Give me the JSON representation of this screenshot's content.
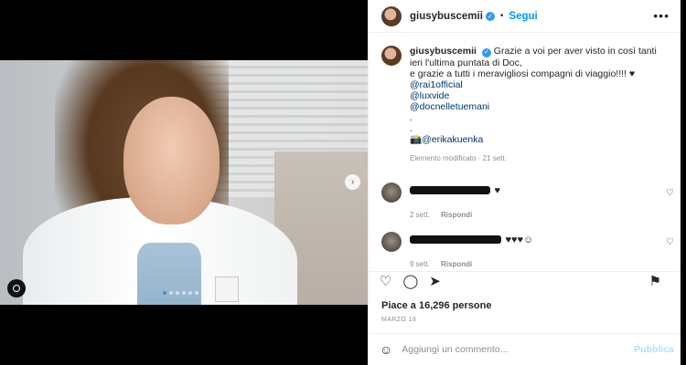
{
  "post": {
    "username": "giusybuscemii",
    "separator": "•",
    "follow_label": "Segui",
    "more_icon": "more-icon",
    "caption": {
      "username": "giusybuscemii",
      "line1": "Grazie a voi per aver visto in così tanti ieri l'ultima puntata di Doc,",
      "line2": "e grazie a tutti i meravigliosi compagni di viaggio!!!! ♥",
      "mentions": [
        "@rai1official",
        "@luxvide",
        "@docnelletuemani"
      ],
      "dots": [
        ".",
        "."
      ],
      "photo_credit": "📸@erikakuenka",
      "meta": "Elemento modificato · 21 sett."
    },
    "comments": [
      {
        "suffix": "♥",
        "time": "2 sett.",
        "reply_label": "Rispondi"
      },
      {
        "suffix": "♥♥♥☺",
        "time": "9 sett.",
        "reply_label": "Rispondi"
      }
    ],
    "likes": "Piace a 16,296 persone",
    "date": "MARZO 18",
    "comment_placeholder": "Aggiungi un commento...",
    "publish_label": "Pubblica",
    "carousel": {
      "count": 6,
      "active_index": 0
    }
  },
  "colors": {
    "accent": "#0095f6",
    "publish_disabled": "#b2dffc",
    "verified": "#3897f0",
    "mention": "#00376b"
  }
}
